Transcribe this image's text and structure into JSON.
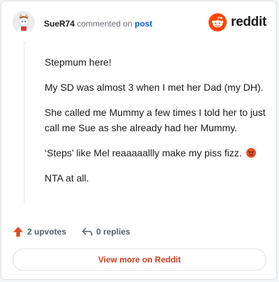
{
  "header": {
    "username": "SueR74",
    "action_text": "commented on",
    "post_link": "post",
    "logo_text": "reddit"
  },
  "comment": {
    "paragraphs": [
      "Stepmum here!",
      "My SD was almost 3 when I met her Dad (my DH).",
      "She called me Mummy a few times I told her to just call me Sue as she already had her Mummy.",
      "‘Steps’ like Mel reaaaaallly make my piss fizz.",
      "NTA at all."
    ],
    "emoji": "angry-face"
  },
  "footer": {
    "upvotes": "2 upvotes",
    "replies": "0 replies"
  },
  "cta": {
    "label": "View more on Reddit"
  },
  "colors": {
    "brand": "#ff4500",
    "link": "#0b5fd3",
    "cta_text": "#c7401c"
  }
}
